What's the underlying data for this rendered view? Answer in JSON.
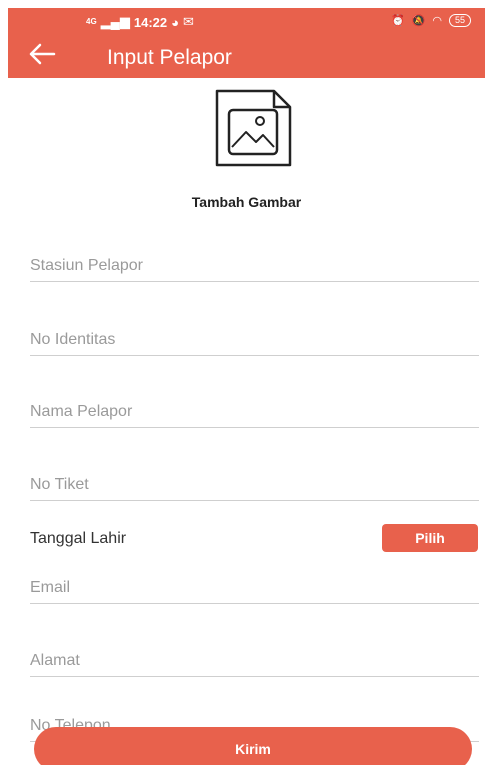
{
  "status_bar": {
    "network": "4G",
    "time": "14:22",
    "battery": "55"
  },
  "appbar": {
    "title": "Input Pelapor",
    "back_icon": "arrow-left-icon"
  },
  "image_picker": {
    "icon": "image-file-icon",
    "label": "Tambah Gambar"
  },
  "form": {
    "fields": [
      {
        "placeholder": "Stasiun Pelapor",
        "value": ""
      },
      {
        "placeholder": "No Identitas",
        "value": ""
      },
      {
        "placeholder": "Nama Pelapor",
        "value": ""
      },
      {
        "placeholder": "No Tiket",
        "value": ""
      },
      {
        "placeholder": "Email",
        "value": ""
      },
      {
        "placeholder": "Alamat",
        "value": ""
      },
      {
        "placeholder": "No Telepon",
        "value": ""
      }
    ],
    "date_label": "Tanggal Lahir",
    "pick_button": "Pilih",
    "submit_button": "Kirim"
  },
  "colors": {
    "accent": "#e8614c",
    "divider": "#cfcfcf",
    "placeholder": "#9a9a9a"
  }
}
